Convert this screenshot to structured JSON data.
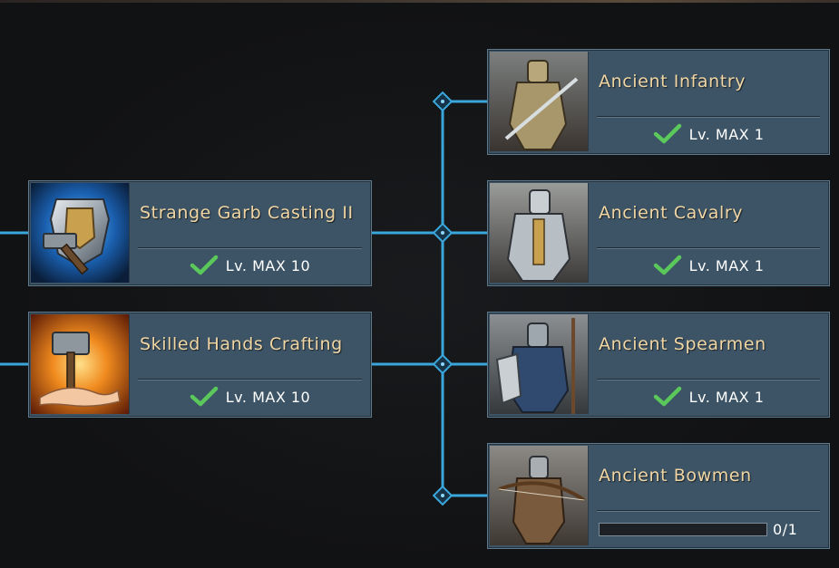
{
  "colors": {
    "connector": "#3aa7dc",
    "card_bg": "#3c5465",
    "title": "#f0d6a4",
    "check": "#5ac85a"
  },
  "skills": [
    {
      "title": "Strange Garb Casting II",
      "status": "Lv. MAX 10",
      "icon": "armor-hammer-icon",
      "completed": true
    },
    {
      "title": "Skilled Hands Crafting",
      "status": "Lv. MAX 10",
      "icon": "forge-hammer-icon",
      "completed": true
    }
  ],
  "units": [
    {
      "title": "Ancient Infantry",
      "status": "Lv. MAX 1",
      "icon": "infantry-knight-icon",
      "completed": true
    },
    {
      "title": "Ancient Cavalry",
      "status": "Lv. MAX 1",
      "icon": "cavalry-knight-icon",
      "completed": true
    },
    {
      "title": "Ancient Spearmen",
      "status": "Lv. MAX 1",
      "icon": "spearman-knight-icon",
      "completed": true
    },
    {
      "title": "Ancient Bowmen",
      "progress_text": "0/1",
      "progress_fraction": 0,
      "icon": "bowman-icon",
      "completed": false
    }
  ]
}
